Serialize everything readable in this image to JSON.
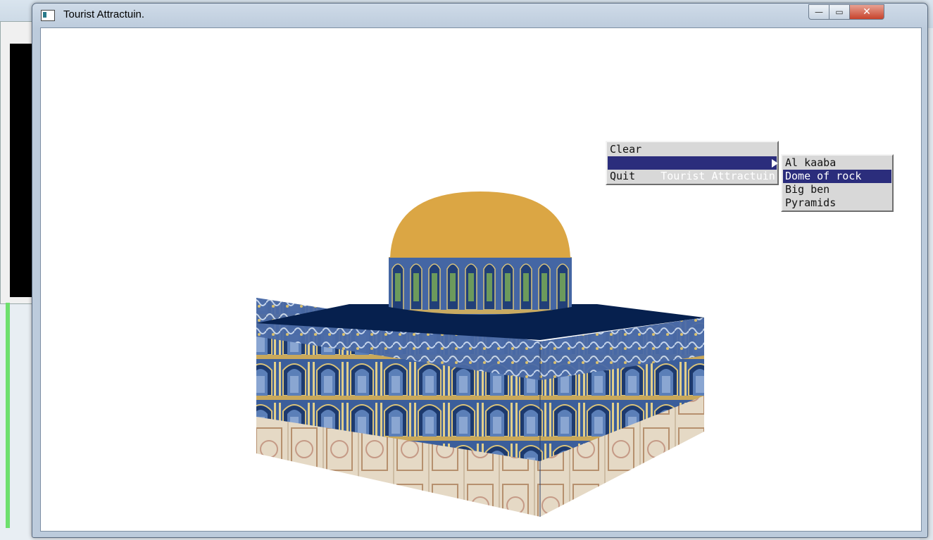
{
  "window": {
    "title": "Tourist Attractuin.",
    "minimize_glyph": "—",
    "maximize_glyph": "▭",
    "close_glyph": "✕"
  },
  "menu": {
    "items": [
      "Clear",
      "Tourist Attractuin",
      "Quit"
    ],
    "selected_index": 1
  },
  "submenu": {
    "items": [
      "Al kaaba",
      "Dome of rock",
      "Big ben",
      "Pyramids"
    ],
    "selected_index": 1
  },
  "scene": {
    "subject": "dome-of-the-rock-model",
    "colors": {
      "dome": "#dba644",
      "roof": "#06204e",
      "tile_blue": "#3a5e9c",
      "stone": "#e3d7c3"
    }
  },
  "icons": [
    "window-app-icon",
    "minimize-icon",
    "maximize-icon",
    "close-icon",
    "submenu-arrow-icon"
  ]
}
